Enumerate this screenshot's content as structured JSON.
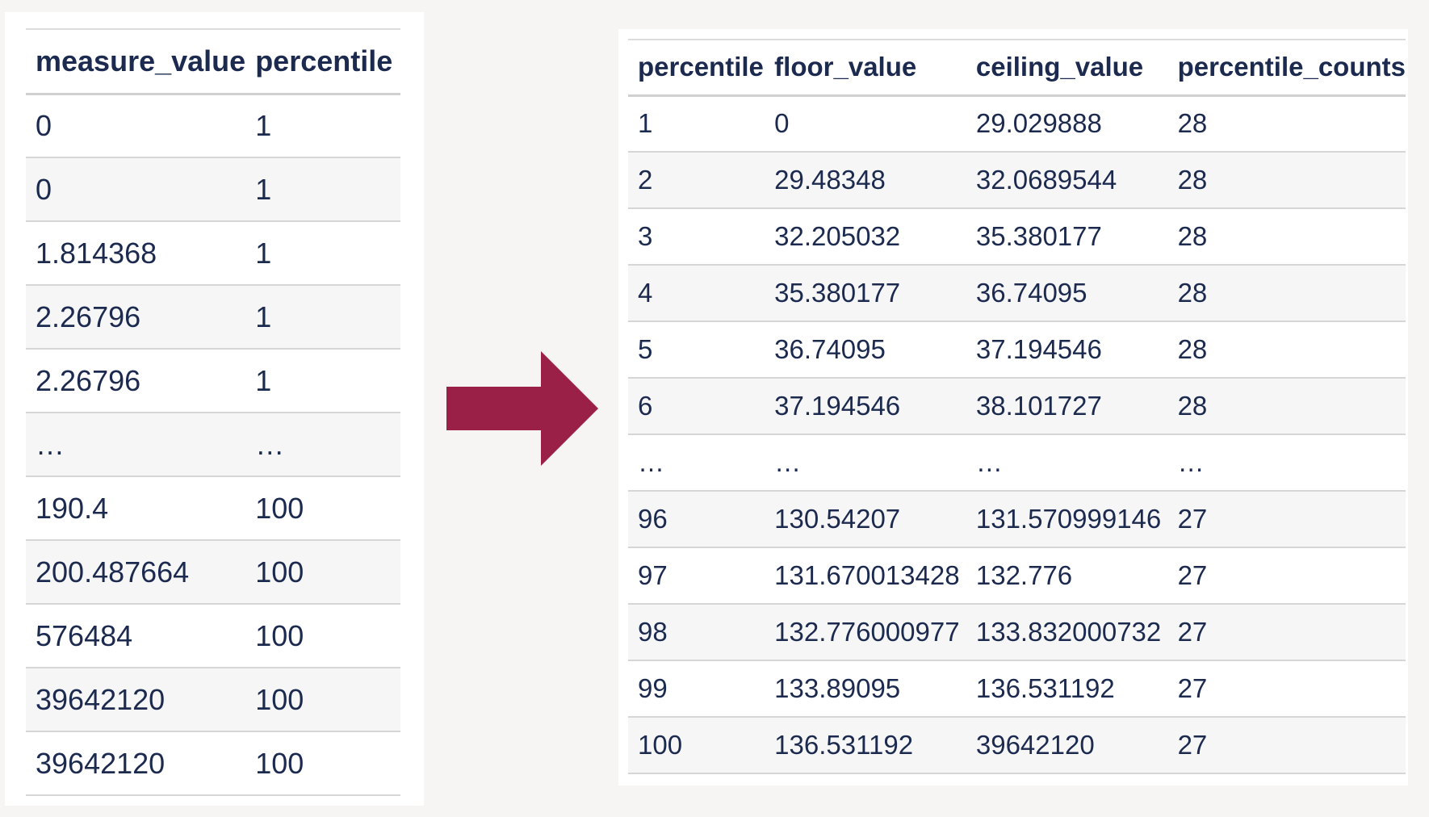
{
  "left_table": {
    "headers": [
      "measure_value",
      "percentile"
    ],
    "rows": [
      [
        "0",
        "1"
      ],
      [
        "0",
        "1"
      ],
      [
        "1.814368",
        "1"
      ],
      [
        "2.26796",
        "1"
      ],
      [
        "2.26796",
        "1"
      ],
      [
        "…",
        "…"
      ],
      [
        "190.4",
        "100"
      ],
      [
        "200.487664",
        "100"
      ],
      [
        "576484",
        "100"
      ],
      [
        "39642120",
        "100"
      ],
      [
        "39642120",
        "100"
      ]
    ]
  },
  "right_table": {
    "headers": [
      "percentile",
      "floor_value",
      "ceiling_value",
      "percentile_counts"
    ],
    "rows": [
      [
        "1",
        "0",
        "29.029888",
        "28"
      ],
      [
        "2",
        "29.48348",
        "32.0689544",
        "28"
      ],
      [
        "3",
        "32.205032",
        "35.380177",
        "28"
      ],
      [
        "4",
        "35.380177",
        "36.74095",
        "28"
      ],
      [
        "5",
        "36.74095",
        "37.194546",
        "28"
      ],
      [
        "6",
        "37.194546",
        "38.101727",
        "28"
      ],
      [
        "…",
        "…",
        "…",
        "…"
      ],
      [
        "96",
        "130.54207",
        "131.570999146",
        "27"
      ],
      [
        "97",
        "131.670013428",
        "132.776",
        "27"
      ],
      [
        "98",
        "132.776000977",
        "133.832000732",
        "27"
      ],
      [
        "99",
        "133.89095",
        "136.531192",
        "27"
      ],
      [
        "100",
        "136.531192",
        "39642120",
        "27"
      ]
    ]
  },
  "arrow": {
    "icon": "right-arrow-icon",
    "color": "#9b2048"
  }
}
